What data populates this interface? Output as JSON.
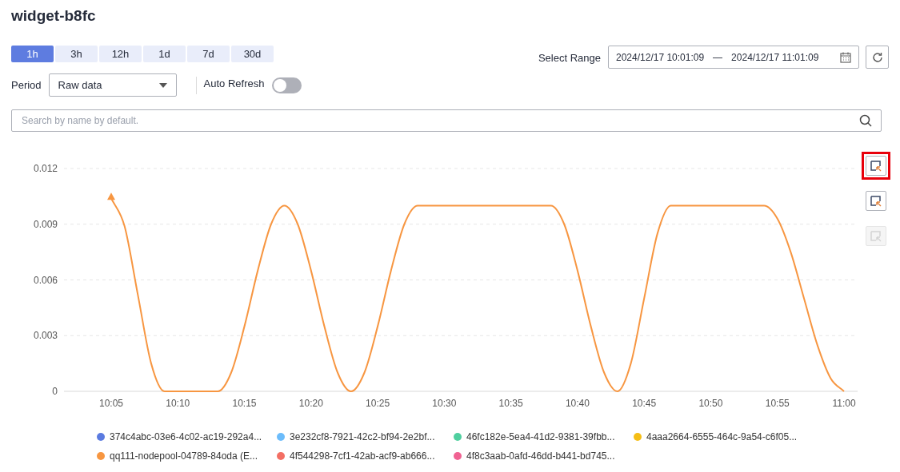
{
  "title": "widget-b8fc",
  "time_tabs": [
    {
      "label": "1h",
      "selected": true
    },
    {
      "label": "3h",
      "selected": false
    },
    {
      "label": "12h",
      "selected": false
    },
    {
      "label": "1d",
      "selected": false
    },
    {
      "label": "7d",
      "selected": false
    },
    {
      "label": "30d",
      "selected": false
    }
  ],
  "period": {
    "label": "Period",
    "value": "Raw data"
  },
  "auto_refresh": {
    "label": "Auto Refresh",
    "on": false
  },
  "range": {
    "label": "Select Range",
    "start": "2024/12/17 10:01:09",
    "separator": "—",
    "end": "2024/12/17 11:01:09"
  },
  "search": {
    "placeholder": "Search by name by default."
  },
  "zoom_tools": [
    {
      "highlighted": true,
      "disabled": false
    },
    {
      "highlighted": false,
      "disabled": false
    },
    {
      "highlighted": false,
      "disabled": true
    }
  ],
  "chart_data": {
    "type": "line",
    "categories": [
      "10:05",
      null,
      null,
      null,
      null,
      "10:10",
      null,
      null,
      null,
      null,
      "10:15",
      null,
      null,
      null,
      null,
      "10:20",
      null,
      null,
      null,
      null,
      "10:25",
      null,
      null,
      null,
      null,
      "10:30",
      null,
      null,
      null,
      null,
      "10:35",
      null,
      null,
      null,
      null,
      "10:40",
      null,
      null,
      null,
      null,
      "10:45",
      null,
      null,
      null,
      null,
      "10:50",
      null,
      null,
      null,
      null,
      "10:55",
      null,
      null,
      null,
      null,
      "11:00"
    ],
    "series": [
      {
        "color": "#f79641",
        "values": [
          0.0104,
          0.0089,
          0.0052,
          0.0015,
          0,
          0,
          0,
          0,
          0,
          0.001,
          0.0035,
          0.0065,
          0.009,
          0.01,
          0.009,
          0.0065,
          0.0035,
          0.001,
          0,
          0.001,
          0.0035,
          0.0065,
          0.009,
          0.01,
          0.01,
          0.01,
          0.01,
          0.01,
          0.01,
          0.01,
          0.01,
          0.01,
          0.01,
          0.01,
          0.009,
          0.0065,
          0.0035,
          0.001,
          0,
          0.0015,
          0.005,
          0.0085,
          0.01,
          0.01,
          0.01,
          0.01,
          0.01,
          0.01,
          0.01,
          0.01,
          0.0093,
          0.0075,
          0.005,
          0.0025,
          0.0007,
          0
        ]
      }
    ],
    "ylim": [
      0,
      0.012
    ],
    "grid": true,
    "yticks": [
      {
        "value": 0,
        "label": "0"
      },
      {
        "value": 0.003,
        "label": "0.003"
      },
      {
        "value": 0.006,
        "label": "0.006"
      },
      {
        "value": 0.009,
        "label": "0.009"
      },
      {
        "value": 0.012,
        "label": "0.012"
      }
    ]
  },
  "legend": [
    {
      "label": "374c4abc-03e6-4c02-ac19-292a4...",
      "color": "#5b7be0"
    },
    {
      "label": "3e232cf8-7921-42c2-bf94-2e2bf...",
      "color": "#6cbcfb"
    },
    {
      "label": "46fc182e-5ea4-41d2-9381-39fbb...",
      "color": "#4fcf9f"
    },
    {
      "label": "4aaa2664-6555-464c-9a54-c6f05...",
      "color": "#f5be15"
    },
    {
      "label": "qq111-nodepool-04789-84oda (E...",
      "color": "#f79641"
    },
    {
      "label": "4f544298-7cf1-42ab-acf9-ab666...",
      "color": "#f36f64"
    },
    {
      "label": "4f8c3aab-0afd-46dd-b441-bd745...",
      "color": "#f06292"
    }
  ]
}
